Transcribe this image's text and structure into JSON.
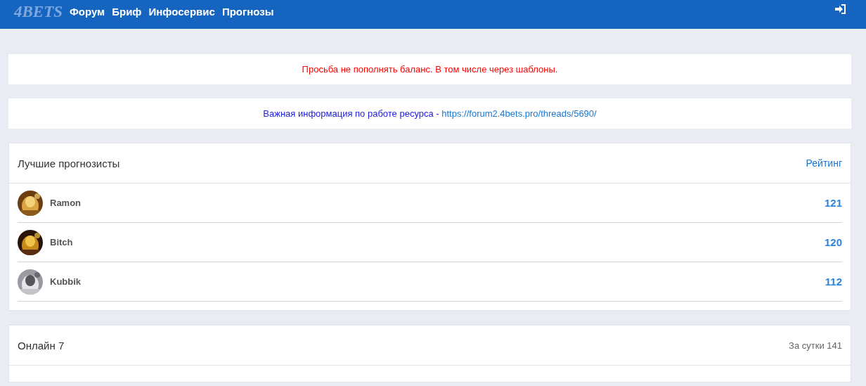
{
  "nav": {
    "logo": "4BETS",
    "links": [
      {
        "label": "Форум"
      },
      {
        "label": "Бриф"
      },
      {
        "label": "Инфосервис"
      },
      {
        "label": "Прогнозы"
      }
    ]
  },
  "notices": [
    {
      "kind": "warning",
      "text": "Просьба не пополнять баланс. В том числе через шаблоны."
    },
    {
      "kind": "info",
      "text": "Важная информация по работе ресурса - ",
      "link": "https://forum2.4bets.pro/threads/5690/"
    }
  ],
  "top_forecasters": {
    "title": "Лучшие прогнозисты",
    "link": "Рейтинг",
    "users": [
      {
        "name": "Ramon",
        "score": "121"
      },
      {
        "name": "Bitch",
        "score": "120"
      },
      {
        "name": "Kubbik",
        "score": "112"
      }
    ]
  },
  "online": {
    "title": "Онлайн 7",
    "daily": "За сутки 141"
  }
}
